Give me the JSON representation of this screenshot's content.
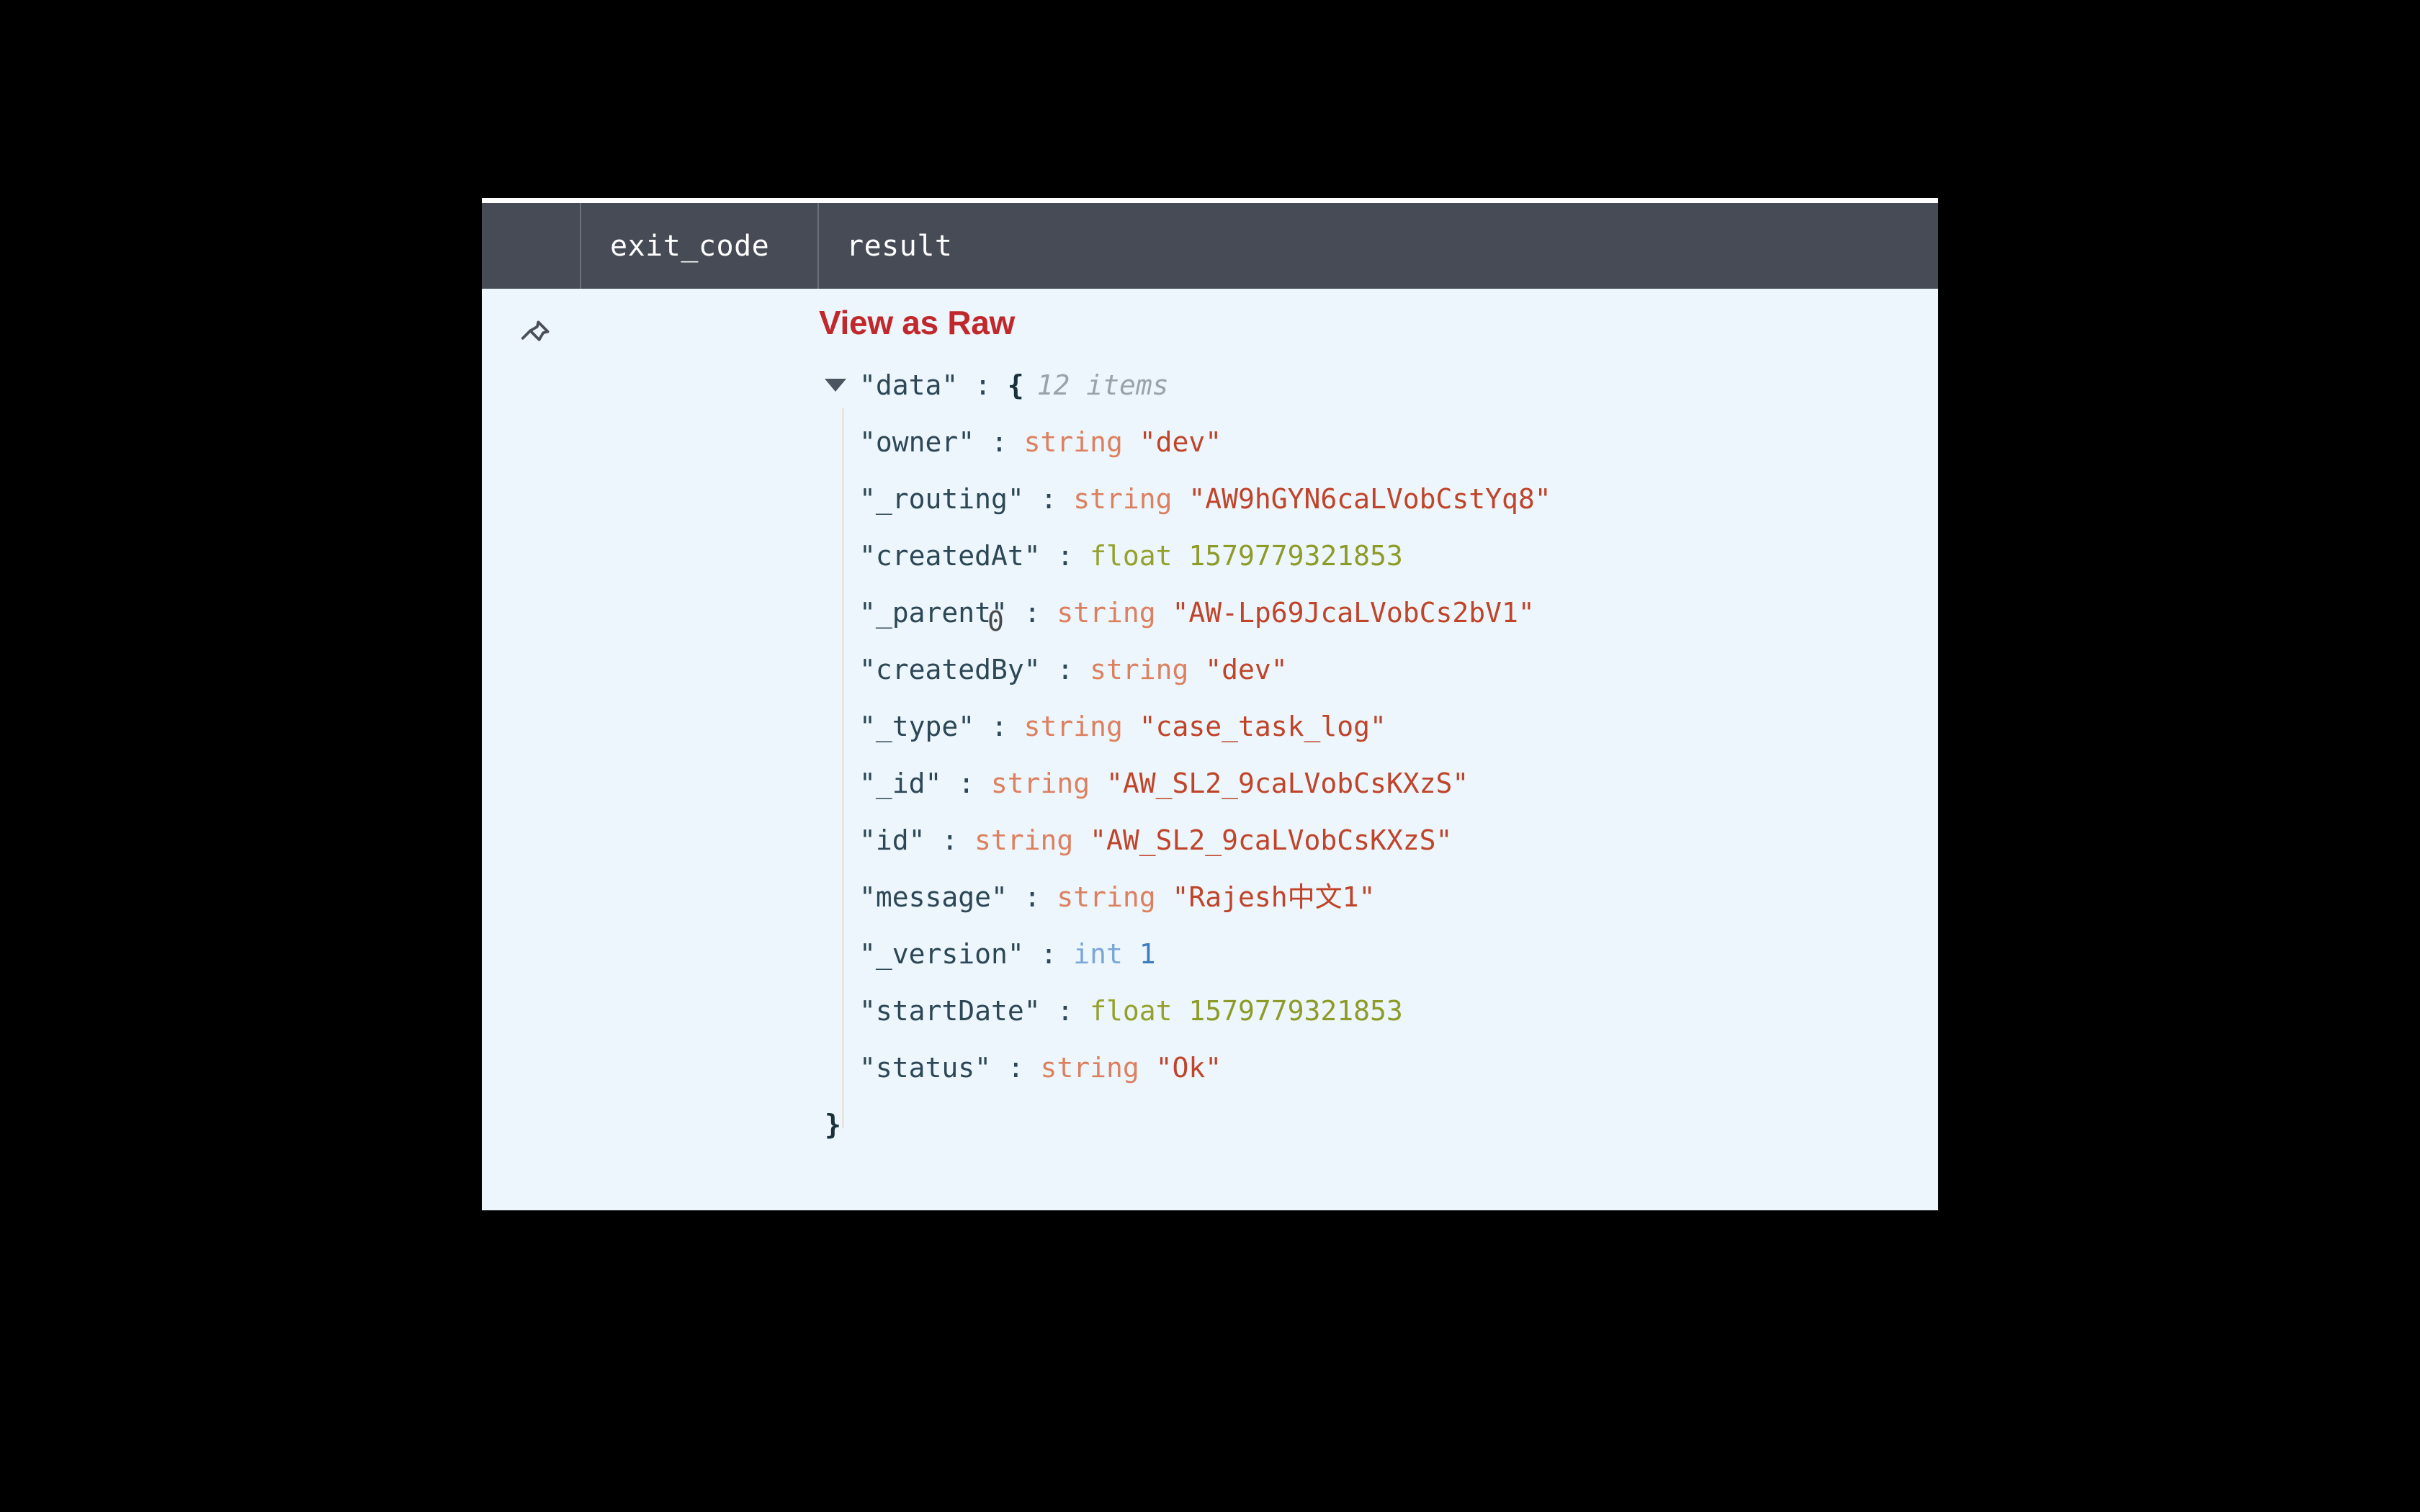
{
  "panel": {
    "columns": [
      {
        "id": "pin",
        "label": ""
      },
      {
        "id": "exit_code",
        "label": "exit_code"
      },
      {
        "id": "result",
        "label": "result"
      }
    ],
    "header": {
      "exit_code_label": "exit_code",
      "result_label": "result"
    },
    "row": {
      "pin_icon": "pin-icon",
      "exit_code_value": "0",
      "view_as_raw_label": "View as Raw"
    },
    "colors": {
      "header_background": "#464b55",
      "body_background": "#ecf6fc",
      "accent_link": "#c0282b",
      "key_text": "#2e4756",
      "type_string": "#dd8060",
      "value_string": "#c0442a",
      "type_float": "#94a22c",
      "value_float": "#8d9b27",
      "type_int": "#7ba7d7",
      "value_int": "#3f7cc0",
      "item_count": "#9aa3a8",
      "indent_guide": "#ece4dc"
    }
  },
  "json": {
    "root": {
      "key": "\"data\"",
      "colon": ":",
      "brace_open": "{",
      "count_label": "12 items",
      "brace_close": "}",
      "expanded": true
    },
    "entries": [
      {
        "key": "\"owner\"",
        "colon": ":",
        "type": "string",
        "value": "\"dev\""
      },
      {
        "key": "\"_routing\"",
        "colon": ":",
        "type": "string",
        "value": "\"AW9hGYN6caLVobCstYq8\""
      },
      {
        "key": "\"createdAt\"",
        "colon": ":",
        "type": "float",
        "value": "1579779321853"
      },
      {
        "key": "\"_parent\"",
        "colon": ":",
        "type": "string",
        "value": "\"AW-Lp69JcaLVobCs2bV1\""
      },
      {
        "key": "\"createdBy\"",
        "colon": ":",
        "type": "string",
        "value": "\"dev\""
      },
      {
        "key": "\"_type\"",
        "colon": ":",
        "type": "string",
        "value": "\"case_task_log\""
      },
      {
        "key": "\"_id\"",
        "colon": ":",
        "type": "string",
        "value": "\"AW_SL2_9caLVobCsKXzS\""
      },
      {
        "key": "\"id\"",
        "colon": ":",
        "type": "string",
        "value": "\"AW_SL2_9caLVobCsKXzS\""
      },
      {
        "key": "\"message\"",
        "colon": ":",
        "type": "string",
        "value": "\"Rajesh中文1\""
      },
      {
        "key": "\"_version\"",
        "colon": ":",
        "type": "int",
        "value": "1"
      },
      {
        "key": "\"startDate\"",
        "colon": ":",
        "type": "float",
        "value": "1579779321853"
      },
      {
        "key": "\"status\"",
        "colon": ":",
        "type": "string",
        "value": "\"Ok\""
      }
    ]
  }
}
